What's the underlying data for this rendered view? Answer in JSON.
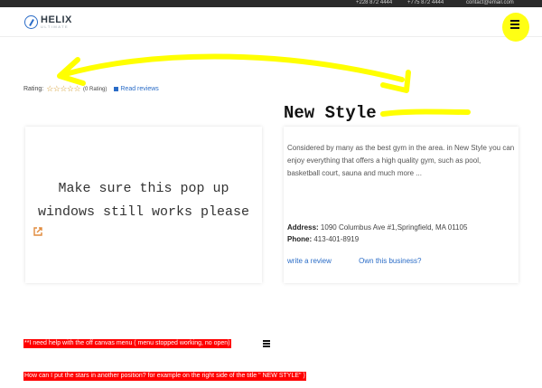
{
  "topbar": {
    "phone1": "+228 872 4444",
    "phone2": "+775 872 4444",
    "email": "contact@email.com"
  },
  "logo": {
    "main": "HELIX",
    "sub": "ULTIMATE"
  },
  "rating": {
    "label": "Rating:",
    "stars": "☆☆☆☆☆",
    "count": "(0 Rating)",
    "read_reviews": "Read reviews"
  },
  "listing": {
    "title": "New Style",
    "description": "Considered by many as the best gym in the area. in New Style you can enjoy everything that offers a high quality gym, such as pool, basketball court, sauna and much more ...",
    "address_label": "Address:",
    "address": "1090 Columbus Ave #1,Springfield, MA 01105",
    "phone_label": "Phone:",
    "phone": "413-401-8919",
    "write_review": "write a review",
    "own_business": "Own this business?"
  },
  "popup": {
    "line1": "Make sure this pop up",
    "line2": "windows still works please"
  },
  "notes": {
    "note1": "**I need help with the off canvas menu ( menu stopped working, no  open)",
    "note2": "How can I put the stars in another position? for example on the right side of the title \" NEW STYLE\" )"
  },
  "colors": {
    "accent": "#2a6cc7",
    "highlight": "#ffff00",
    "note_bg": "#ff0000",
    "star": "#d39a2b"
  }
}
